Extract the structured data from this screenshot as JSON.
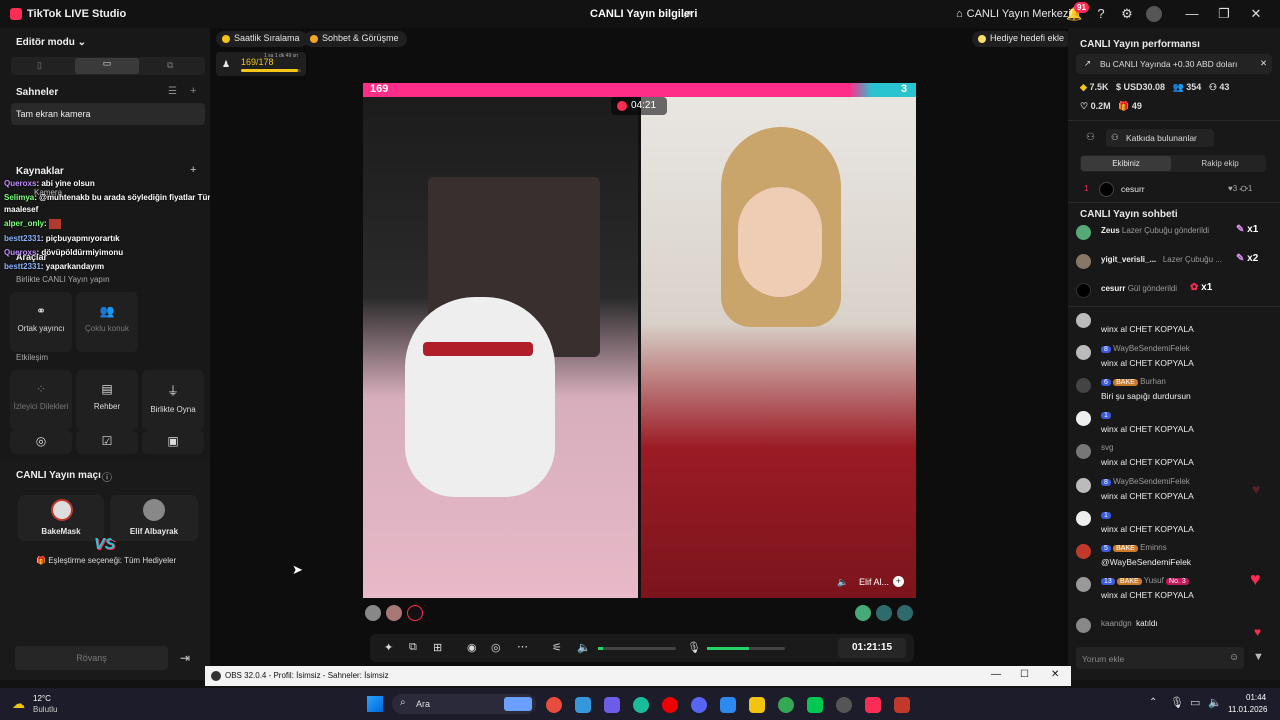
{
  "titlebar": {
    "app_name": "TikTok LIVE Studio",
    "center_title": "CANLI Yayın bilgileri",
    "live_center": "CANLI Yayın Merkezi",
    "notif_count": "91"
  },
  "left": {
    "editor_mode": "Editör modu",
    "scenes_title": "Sahneler",
    "scene_item": "Tam ekran kamera",
    "sources_title": "Kaynaklar",
    "camera": "Kamera",
    "tools_title": "Araçlar",
    "collab_title": "Birlikte CANLI Yayın yapın",
    "collab_items": [
      "Ortak yayıncı",
      "Çoklu konuk"
    ],
    "interaction_title": "Etkileşim",
    "interaction_items": [
      "İzleyici Dilekleri",
      "Rehber",
      "Birlikte Oyna"
    ],
    "match_title": "CANLI Yayın maçı",
    "player1": "BakeMask",
    "player2": "Elif Albayrak",
    "vs": "VS",
    "match_option": "Eşleştirme seçeneği: Tüm Hediyeler",
    "rematch": "Rövanş"
  },
  "overlay_chat": [
    {
      "user": "Queroxs",
      "text": ": abi yine olsun"
    },
    {
      "user": "Selimya",
      "text": ": @muhtenakb bu arada söylediğin fiyatlar Türkiye'de de neredeyse aynı şaka gibi ama"
    },
    {
      "user": "",
      "text": "maalesef"
    },
    {
      "user": "alper_only",
      "text": ":"
    },
    {
      "user": "bestt2331",
      "text": ": piçbuyapmıyorartık"
    },
    {
      "user": "Queroxs",
      "text": ": dövüpöldürmiyimonu"
    },
    {
      "user": "bestt2331",
      "text": ": yaparkandayım"
    }
  ],
  "center": {
    "hourly_rank": "Saatlik Sıralama",
    "chat_meet": "Sohbet & Görüşme",
    "gift_goal": "Hediye hedefi ekle",
    "progress": "169/178",
    "progress_sub": "1 sa 1 dk 49 sn",
    "progress_fraction": 0.95,
    "score_left": "169",
    "score_right": "3",
    "timer": "04:21",
    "guest_name": "Elif Al...",
    "elapsed": "01:21:15"
  },
  "right": {
    "perf_title": "CANLI Yayın performansı",
    "banner": "Bu CANLI Yayında +0.30 ABD doları",
    "stats": [
      "7.5K",
      "USD30.08",
      "354",
      "43",
      "0.2M",
      "49"
    ],
    "contributors": "Katkıda bulunanlar",
    "tab_ours": "Ekibiniz",
    "tab_rival": "Rakip ekip",
    "rank_user": "cesurr",
    "rank_no": "1",
    "rank_hearts": "3",
    "rank_gifts": "1",
    "chat_title": "CANLI Yayın sohbeti",
    "gifts": [
      {
        "user": "Zeus",
        "text": "Lazer Çubuğu gönderildi",
        "count": "x1"
      },
      {
        "user": "yigit_verisli_...",
        "text": "Lazer Çubuğu ...",
        "count": "x2"
      },
      {
        "user": "cesurr",
        "text": "Gül gönderildi",
        "count": "x1"
      }
    ],
    "messages": [
      {
        "level": "8",
        "badge": "",
        "name": "WayBeSendemiFelek",
        "text": "winx al CHET KOPYALA"
      },
      {
        "level": "8",
        "badge": "",
        "name": "WayBeSendemiFelek",
        "text": "winx al CHET KOPYALA"
      },
      {
        "level": "6",
        "badge": "BAKE",
        "name": "Burhan",
        "text": "Biri şu sapığı durdursun"
      },
      {
        "level": "1",
        "badge": "",
        "name": "",
        "text": "winx al CHET KOPYALA"
      },
      {
        "level": "",
        "badge": "",
        "name": "svg",
        "text": "winx al CHET KOPYALA"
      },
      {
        "level": "8",
        "badge": "",
        "name": "WayBeSendemiFelek",
        "text": "winx al CHET KOPYALA"
      },
      {
        "level": "1",
        "badge": "",
        "name": "",
        "text": "winx al CHET KOPYALA"
      },
      {
        "level": "5",
        "badge": "BAKE",
        "name": "Eminns",
        "text": "@WayBeSendemiFelek"
      },
      {
        "level": "13",
        "badge": "BAKE",
        "name": "Yusuf",
        "text": "winx al CHET KOPYALA",
        "extra": "No. 3"
      }
    ],
    "joined_user": "kaandgn",
    "joined_text": "katıldı",
    "input_placeholder": "Yorum ekle"
  },
  "obs": {
    "title": "OBS 32.0.4 - Profil: İsimsiz - Sahneler: İsimsiz"
  },
  "taskbar": {
    "temp": "12°C",
    "weather": "Bulutlu",
    "search": "Ara",
    "time": "01:44",
    "date": "11.01.2026"
  },
  "colors": {
    "accent": "#fe2c55",
    "teal": "#2ac3d0",
    "green": "#25d366"
  }
}
